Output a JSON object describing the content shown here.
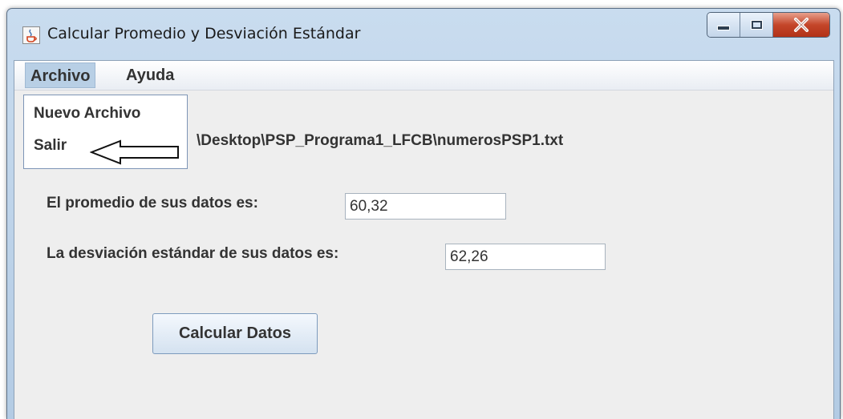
{
  "window": {
    "title": "Calcular Promedio y Desviación Estándar",
    "icon": "java-cup-icon",
    "close_glyph": "X"
  },
  "menubar": {
    "items": [
      {
        "label": "Archivo"
      },
      {
        "label": "Ayuda"
      }
    ]
  },
  "dropdown": {
    "items": [
      {
        "label": "Nuevo Archivo"
      },
      {
        "label": "Salir"
      }
    ]
  },
  "form": {
    "path_text": "\\Desktop\\PSP_Programa1_LFCB\\numerosPSP1.txt",
    "average_label": "El promedio de sus datos es:",
    "average_value": "60,32",
    "stddev_label": "La desviación estándar de sus datos es:",
    "stddev_value": "62,26",
    "calculate_button": "Calcular Datos"
  },
  "colors": {
    "menu_highlight": "#b8cfe5",
    "client_background": "#eeeeee",
    "close_button": "#c4462a"
  }
}
